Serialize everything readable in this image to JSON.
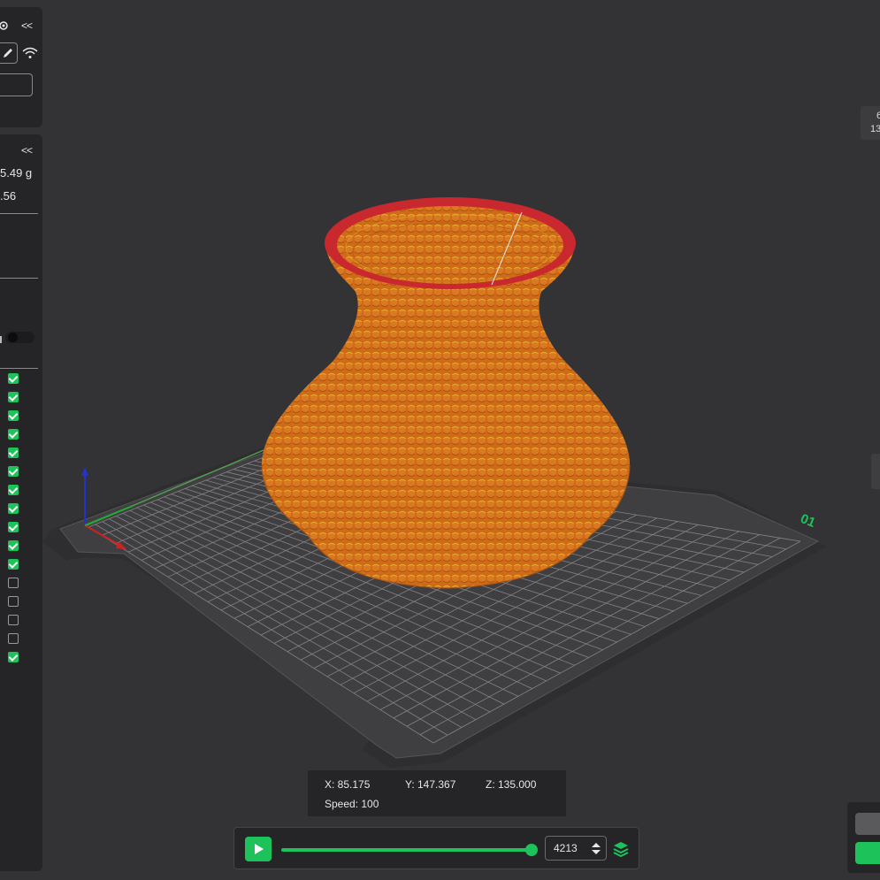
{
  "sidebar": {
    "collapse_label": "<<",
    "weight": "5.49 g",
    "cost": ".56",
    "checkboxes": [
      true,
      true,
      true,
      true,
      true,
      true,
      true,
      true,
      true,
      true,
      true,
      false,
      false,
      false,
      false,
      true
    ]
  },
  "right_stats": {
    "line1": "6",
    "line2": "13"
  },
  "bed": {
    "plate_label": "01"
  },
  "readout": {
    "x": "X: 85.175",
    "y": "Y: 147.367",
    "z": "Z: 135.000",
    "speed": "Speed: 100"
  },
  "playback": {
    "layer": "4213",
    "progress": 1.0
  },
  "colors": {
    "accent": "#1ec25a",
    "model": "#cf6a18",
    "rim": "#c9282e",
    "bed": "#3a3a3c"
  }
}
